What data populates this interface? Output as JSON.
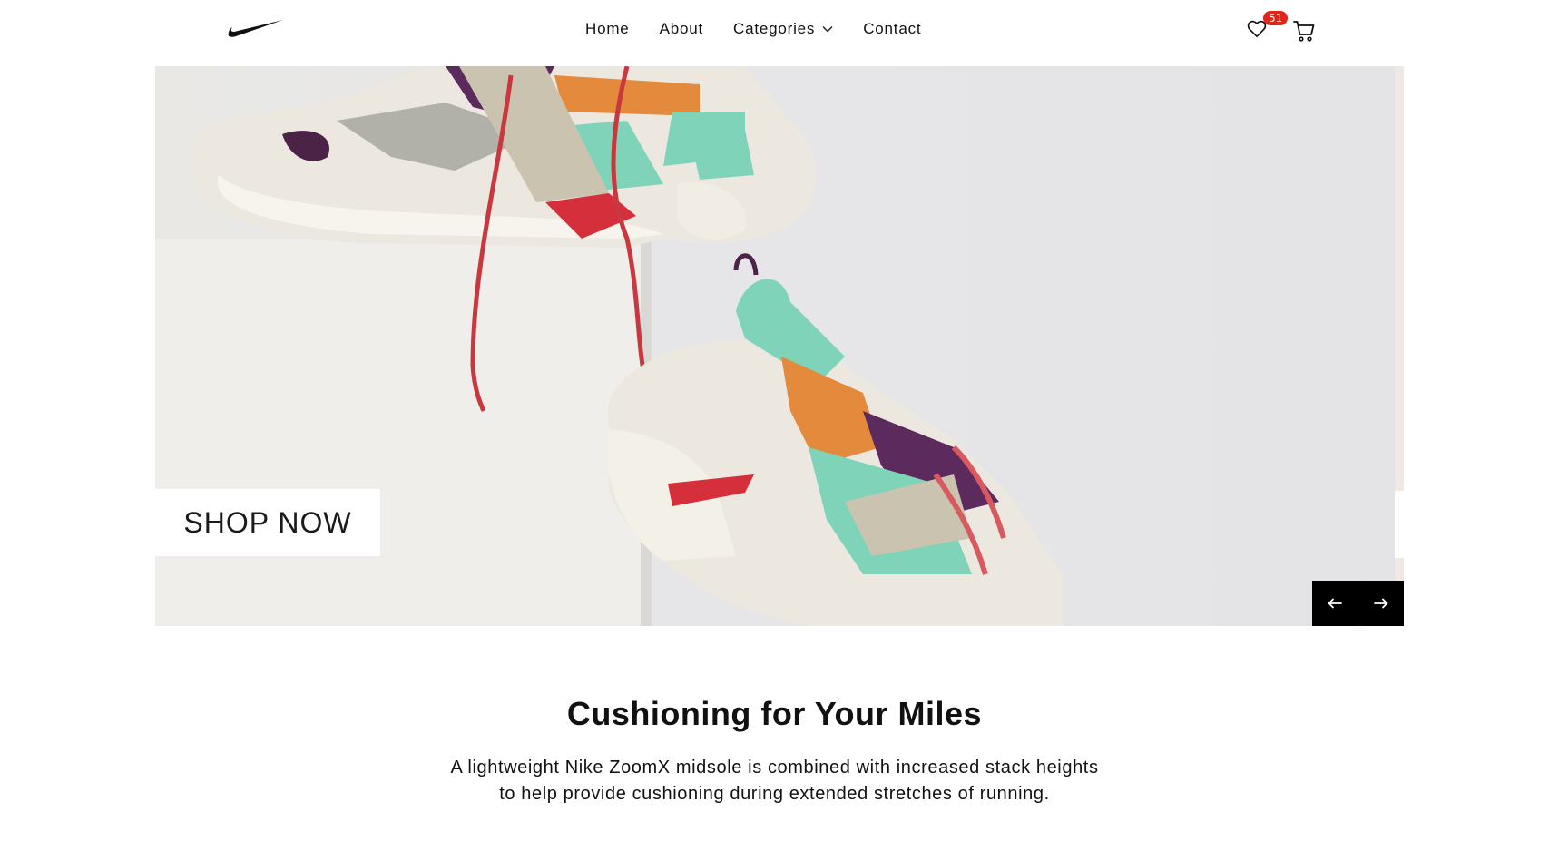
{
  "nav": {
    "items": [
      {
        "label": "Home",
        "has_dropdown": false
      },
      {
        "label": "About",
        "has_dropdown": false
      },
      {
        "label": "Categories",
        "has_dropdown": true
      },
      {
        "label": "Contact",
        "has_dropdown": false
      }
    ]
  },
  "header": {
    "logo_icon": "nike-swoosh-icon",
    "wishlist_icon": "heart-icon",
    "wishlist_count": "51",
    "cart_icon": "cart-icon"
  },
  "hero": {
    "image": "sneakers-on-white-block",
    "cta_label": "SHOP NOW",
    "prev_icon": "arrow-left-icon",
    "next_icon": "arrow-right-icon"
  },
  "feature": {
    "title": "Cushioning for Your Miles",
    "description_line1": "A lightweight Nike ZoomX midsole is combined with increased stack heights",
    "description_line2": "to help provide cushioning during extended stretches of running."
  },
  "colors": {
    "badge": "#e1251b",
    "nav_text": "#111111",
    "arrow_bg": "#000000"
  }
}
